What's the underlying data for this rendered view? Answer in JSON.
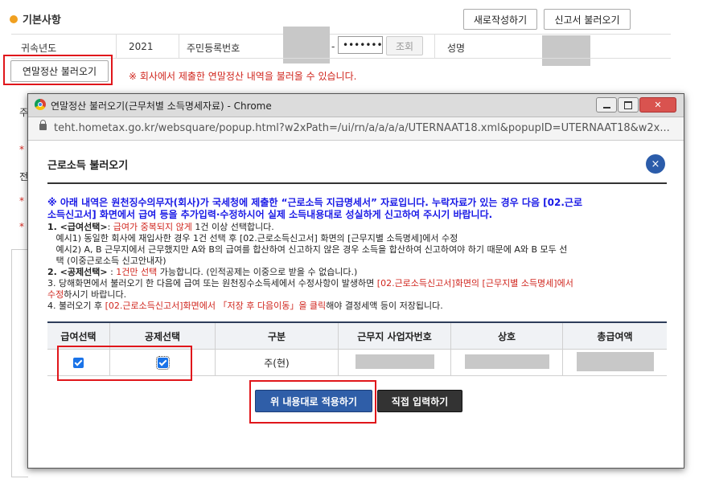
{
  "page": {
    "section_title": "기본사항",
    "new_write_button": "새로작성하기",
    "load_report_button": "신고서 불러오기",
    "year_label": "귀속년도",
    "year_value": "2021",
    "rrn_label": "주민등록번호",
    "rrn_dash": "-",
    "rrn_masked": "•••••••",
    "lookup_button": "조회",
    "name_label": "성명",
    "load_year_end_button": "연말정산 불러오기",
    "notice": "※ 회사에서 제출한 연말정산 내역을 불러올 수 있습니다.",
    "side_chars": [
      "주",
      "*",
      "전",
      "*",
      "*"
    ]
  },
  "popup": {
    "window_title": "연말정산 불러오기(근무처별 소득명세자료) - Chrome",
    "url": "teht.hometax.go.kr/websquare/popup.html?w2xPath=/ui/rn/a/a/a/a/UTERNAAT18.xml&popupID=UTERNAAT18&w2x...",
    "title": "근로소득 불러오기",
    "close_glyph": "×",
    "blue_notice_1": "※ 아래 내역은 원천징수의무자(회사)가 국세청에 제출한 “근로소득 지급명세서” 자료입니다. 누락자료가 있는 경우 다음 [02.근로",
    "blue_notice_2": "소득신고서] 화면에서 급여 등을 추가입력·수정하시어 실제 소득내용대로 성실하게 신고하여 주시기 바랍니다.",
    "line1_a": "1. <급여선택>",
    "line1_b": ": ",
    "line1_c": "급여가 중복되지 않게",
    "line1_d": " 1건 이상 선택합니다.",
    "line1_ex1": "   예시1) 동일한 회사에 재입사한 경우 1건 선택 후 [02.근로소득신고서] 화면의 [근무지별 소득명세]에서 수정",
    "line1_ex2a": "   예시2) A, B 근무지에서 근무했지만 A와 B의 급여를 합산하여 신고하지 않은 경우 소득을 합산하여 신고하여야 하기 때문에 A와 B 모두 선",
    "line1_ex2b": "   택 (이중근로소득 신고안내자)",
    "line2_a": "2. <공제선택>",
    "line2_b": " : ",
    "line2_c": "1건만 선택",
    "line2_d": " 가능합니다. (인적공제는 이중으로 받을 수 없습니다.)",
    "line3_a": "3. 당해화면에서 불러오기 한 다음에 급여 또는 원천징수소득세에서 수정사항이 발생하면 ",
    "line3_b": "[02.근로소득신고서]화면의 [근무지별 소득명세]에서",
    "line3_c": "수정",
    "line3_d": "하시기 바랍니다.",
    "line4_a": "4. 불러오기 후 ",
    "line4_b": "[02.근로소득신고서]화면에서 「저장 후 다음이동」을 클릭",
    "line4_c": "해야 결정세액 등이 저장됩니다.",
    "columns": [
      "급여선택",
      "공제선택",
      "구분",
      "근무지 사업자번호",
      "상호",
      "총급여액"
    ],
    "row_type": "주(현)",
    "apply_button": "위 내용대로 적용하기",
    "direct_input_button": "직접 입력하기"
  },
  "colors": {
    "highlight": "#e0161b",
    "notice_red": "#d0261e",
    "notice_blue": "#1a1ae6",
    "button_blue": "#2f5ea8",
    "button_dark": "#333333"
  }
}
